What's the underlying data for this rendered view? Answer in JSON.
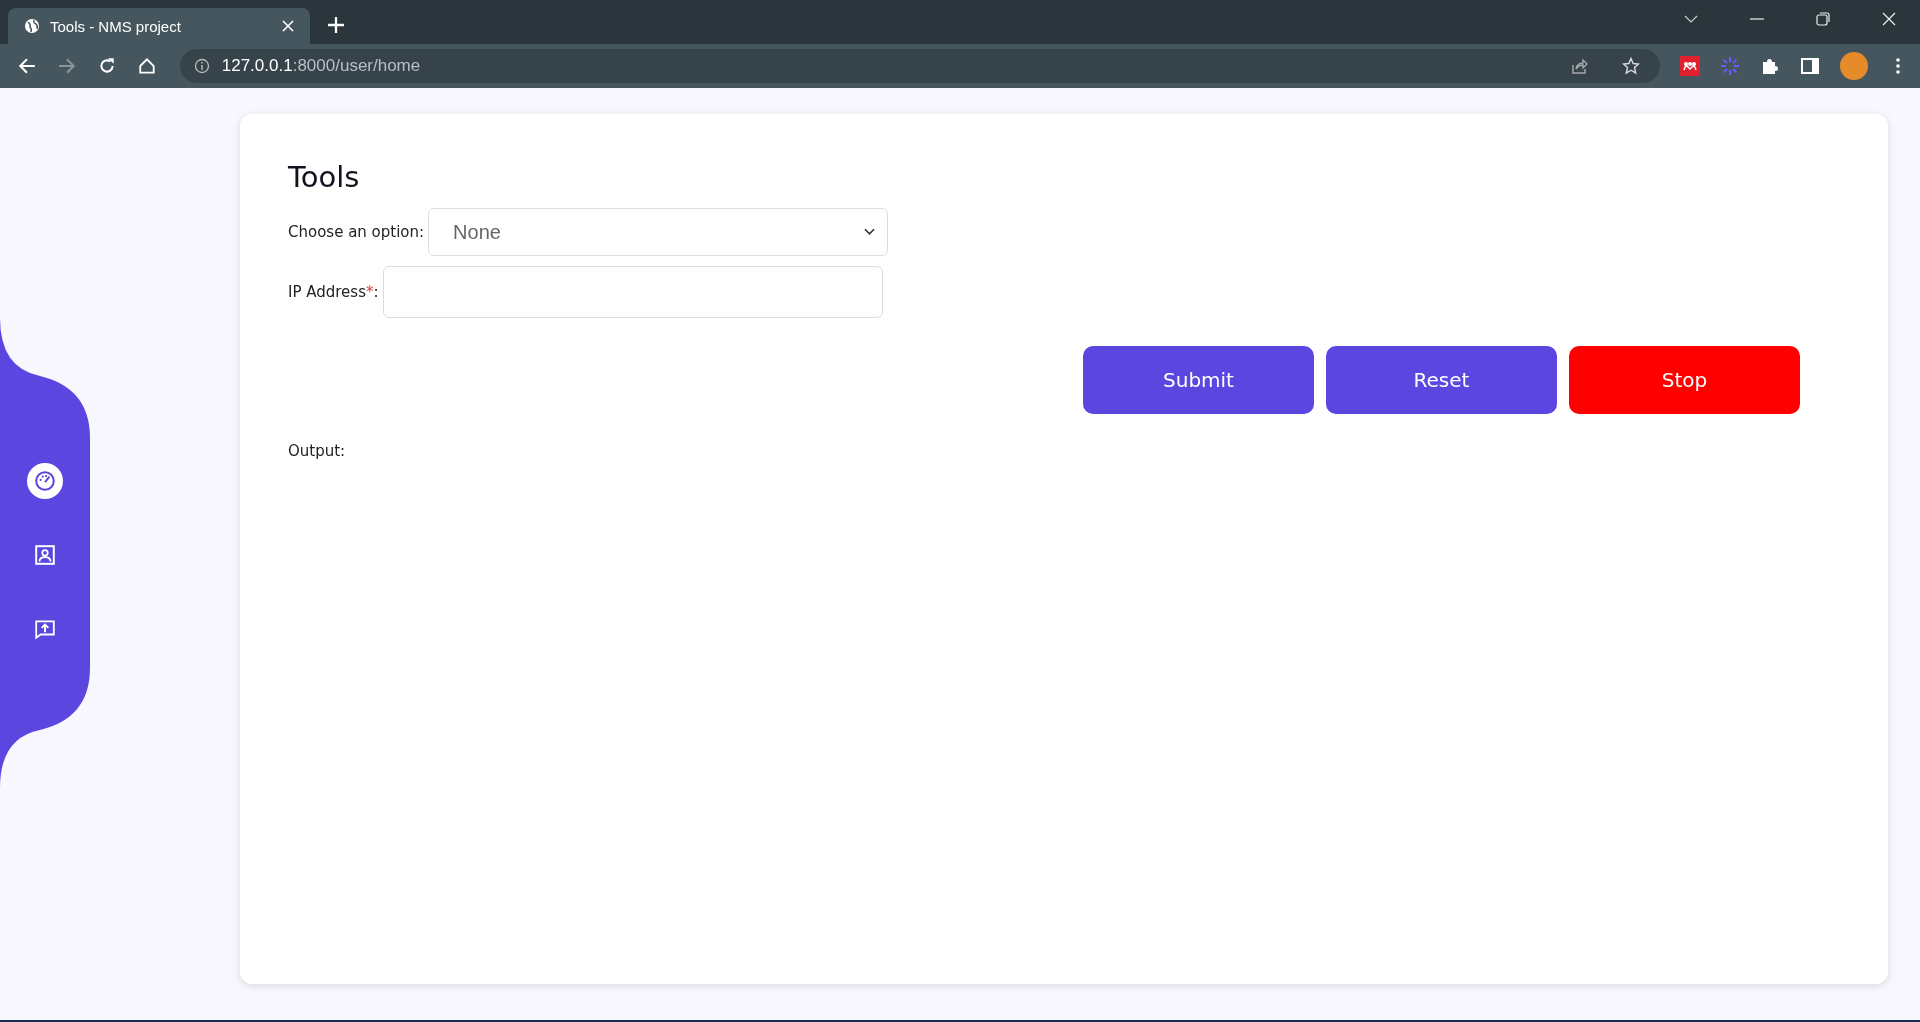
{
  "browser": {
    "tab": {
      "title": "Tools - NMS project",
      "selected": true
    },
    "address": {
      "host": "127.0.0.1",
      "path": ":8000/user/home"
    }
  },
  "sidebar": {
    "items": [
      {
        "kind": "gauge",
        "selected": true
      },
      {
        "kind": "person",
        "selected": false
      },
      {
        "kind": "upload",
        "selected": false
      }
    ]
  },
  "page": {
    "title": "Tools",
    "option_label": "Choose an option:",
    "option_value": "None",
    "ip_label": "IP Address",
    "ip_required_mark": "*",
    "ip_label_suffix": ":",
    "buttons": [
      {
        "label": "Submit",
        "kind": "primary"
      },
      {
        "label": "Reset",
        "kind": "primary"
      },
      {
        "label": "Stop",
        "kind": "danger"
      }
    ],
    "output_label": "Output:"
  }
}
